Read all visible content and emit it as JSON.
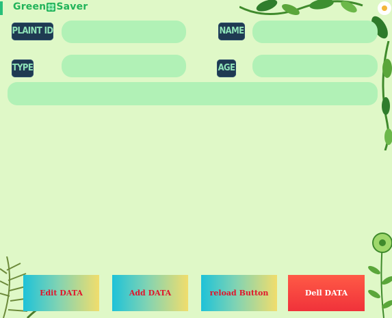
{
  "brand": {
    "name_part1": "Green",
    "name_part2": "Saver"
  },
  "form": {
    "plant_id_label": "PLAINT ID",
    "name_label": "NAME",
    "type_label": "TYPE",
    "age_label": "AGE",
    "plant_id_value": "",
    "name_value": "",
    "type_value": "",
    "age_value": ""
  },
  "buttons": {
    "edit_label": "Edit DATA",
    "add_label": "Add DATA",
    "reload_label": "reload Button",
    "delete_label": "Dell DATA"
  },
  "colors": {
    "background": "#dff8c7",
    "input_fill": "#b1f1b6",
    "label_bg": "#1f3a52",
    "label_text": "#8ee2b8",
    "brand_green": "#22b35a",
    "button_text_red": "#e0162b",
    "delete_button": "#f0323a"
  },
  "icons": {
    "logo": "clover-icon",
    "decor_top": "vine-leaves",
    "decor_right": "vine-leaves",
    "decor_bottom_left": "fern-leaves",
    "decor_bottom_right": "flower-stem"
  }
}
